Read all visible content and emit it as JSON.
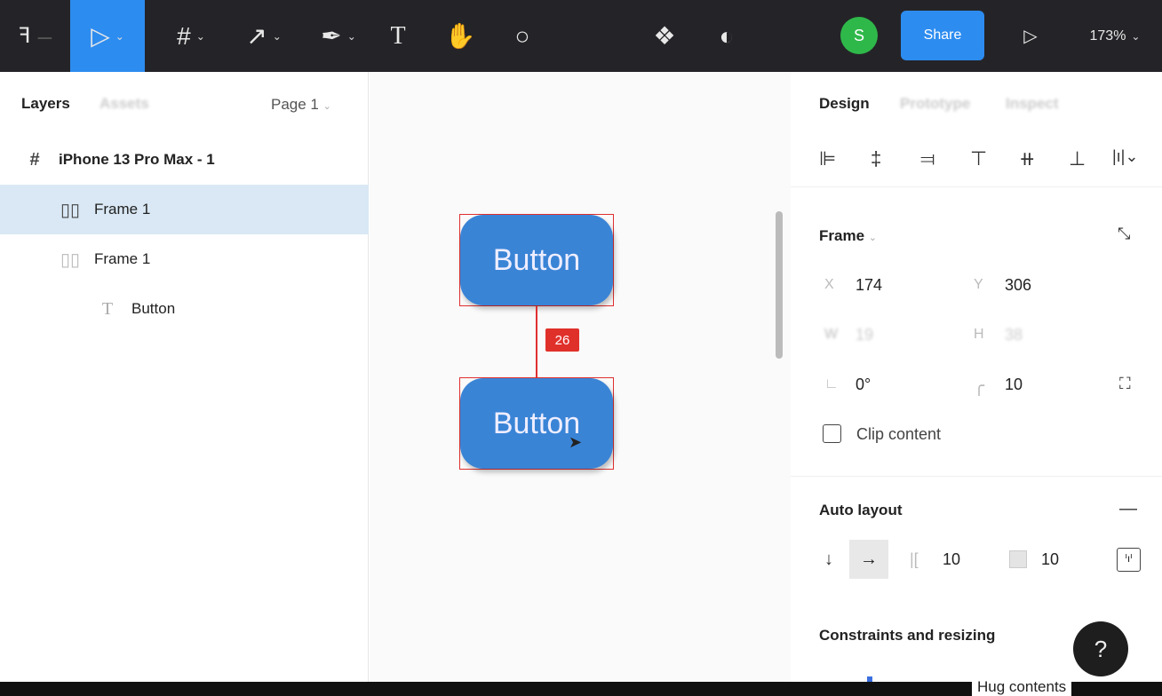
{
  "toolbar": {
    "menu_icon": "figma-logo-icon",
    "tools": [
      "move-tool",
      "frame-tool",
      "line-tool",
      "pen-tool",
      "text-tool",
      "hand-tool",
      "comment-tool"
    ],
    "avatar_initial": "S",
    "avatar_color": "#2fb84a",
    "share_label": "Share",
    "share_color": "#2d8cf0",
    "zoom": "173%",
    "active_color": "#2d8cf0"
  },
  "left": {
    "tabs": [
      "Layers",
      "Assets"
    ],
    "page": "Page 1",
    "layers": [
      {
        "name": "iPhone 13 Pro Max - 1",
        "icon": "frame-icon"
      },
      {
        "name": "Frame 1",
        "icon": "autolayout-icon",
        "selected": true
      },
      {
        "name": "Frame 1",
        "icon": "autolayout-icon"
      },
      {
        "name": "Button",
        "icon": "text-icon"
      }
    ]
  },
  "canvas": {
    "button1": "Button",
    "button2": "Button",
    "spacing": "26"
  },
  "right": {
    "tabs": [
      "Design",
      "Prototype",
      "Inspect"
    ],
    "frame_label": "Frame",
    "x_label": "X",
    "x": "174",
    "y_label": "Y",
    "y": "306",
    "w_label": "W",
    "w": "19",
    "h_label": "H",
    "h": "38",
    "rotation": "0°",
    "radius": "10",
    "clip_content": "Clip content",
    "clip_checked": false,
    "auto_layout": "Auto layout",
    "spacing": "10",
    "padding": "10",
    "constraints": "Constraints and resizing",
    "hug": "Hug contents",
    "help": "?"
  }
}
